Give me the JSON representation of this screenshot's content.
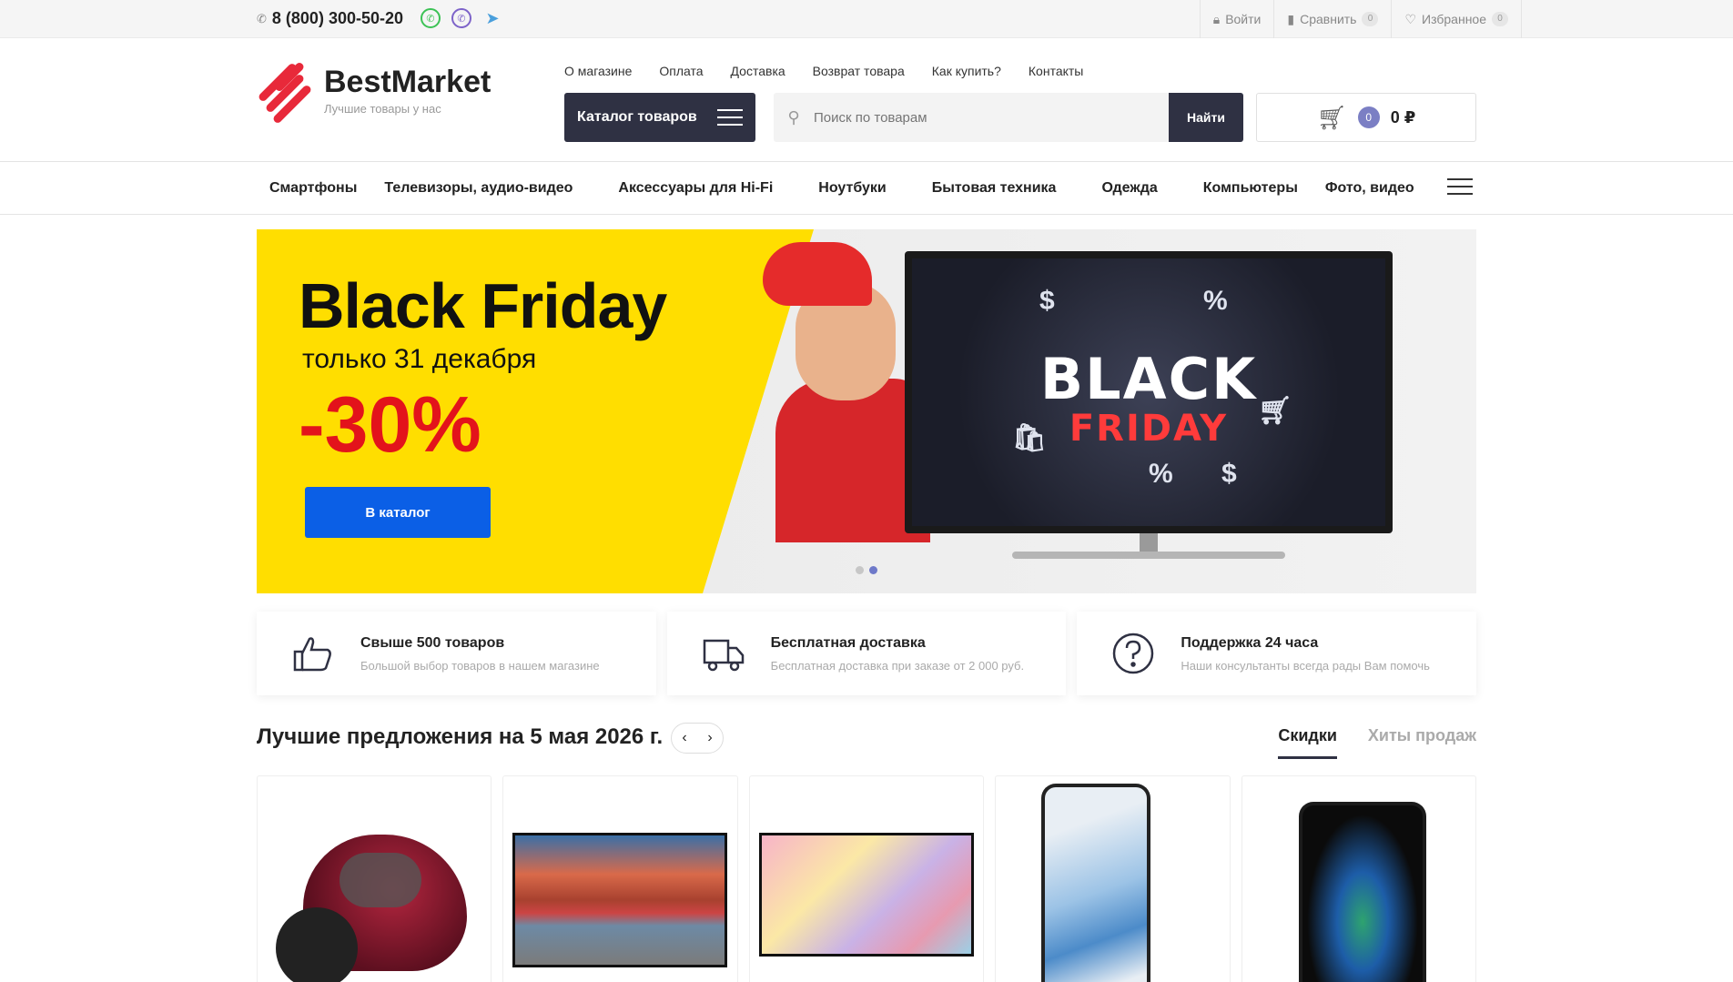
{
  "topbar": {
    "phone": "8 (800) 300-50-20",
    "login": "Войти",
    "compare": "Сравнить",
    "compare_count": "0",
    "favorites": "Избранное",
    "favorites_count": "0"
  },
  "header": {
    "brand": "BestMarket",
    "tagline": "Лучшие товары у нас",
    "menu": [
      "О магазине",
      "Оплата",
      "Доставка",
      "Возврат товара",
      "Как купить?",
      "Контакты"
    ],
    "catalog_button": "Каталог товаров",
    "search_placeholder": "Поиск по товарам",
    "search_button": "Найти",
    "cart_count": "0",
    "cart_sum": "0 ₽"
  },
  "categories": [
    "Смартфоны",
    "Телевизоры, аудио-видео",
    "Аксессуары для Hi-Fi",
    "Ноутбуки",
    "Бытовая техника",
    "Одежда",
    "Компьютеры",
    "Фото, видео"
  ],
  "banner": {
    "title": "Black Friday",
    "subtitle": "только 31 декабря",
    "discount": "-30%",
    "button": "В каталог",
    "tv_line1": "BLACK",
    "tv_line2": "FRIDAY",
    "slides": 2,
    "active_slide": 2
  },
  "features": [
    {
      "title": "Свыше 500 товаров",
      "desc": "Большой выбор товаров в нашем магазине",
      "icon": "thumbs-up-icon"
    },
    {
      "title": "Бесплатная доставка",
      "desc": "Бесплатная доставка при заказе от 2 000 руб.",
      "icon": "truck-icon"
    },
    {
      "title": "Поддержка 24 часа",
      "desc": "Наши консультанты всегда рады Вам помочь",
      "icon": "question-icon"
    }
  ],
  "offers": {
    "title": "Лучшие предложения на 5 мая 2026 г.",
    "tabs": [
      "Скидки",
      "Хиты продаж"
    ],
    "active_tab": "Скидки"
  },
  "colors": {
    "dark": "#2f3143",
    "accent_red": "#e8293a",
    "banner_yellow": "#ffde00",
    "cta_blue": "#0b5fe6"
  }
}
